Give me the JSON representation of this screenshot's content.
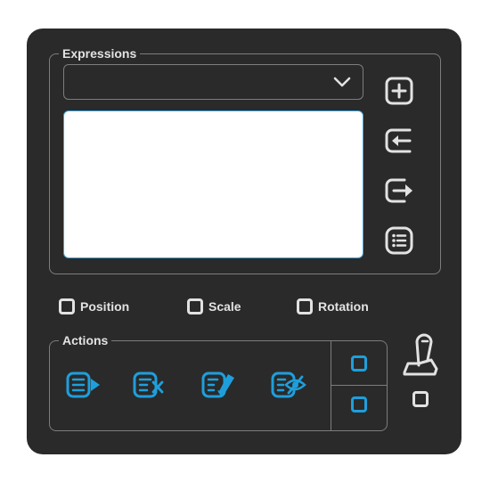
{
  "expressions": {
    "title": "Expressions",
    "dropdown_value": "",
    "textarea_value": ""
  },
  "toggles": [
    {
      "label": "Position",
      "checked": false
    },
    {
      "label": "Scale",
      "checked": false
    },
    {
      "label": "Rotation",
      "checked": false
    }
  ],
  "actions": {
    "title": "Actions",
    "buttons": [
      "apply-list-icon",
      "clear-list-icon",
      "edit-list-icon",
      "hide-list-icon"
    ]
  },
  "colors": {
    "panel": "#2a2a2a",
    "border": "#7d7d7d",
    "text": "#e2e2e2",
    "accent": "#1e9fdc"
  }
}
